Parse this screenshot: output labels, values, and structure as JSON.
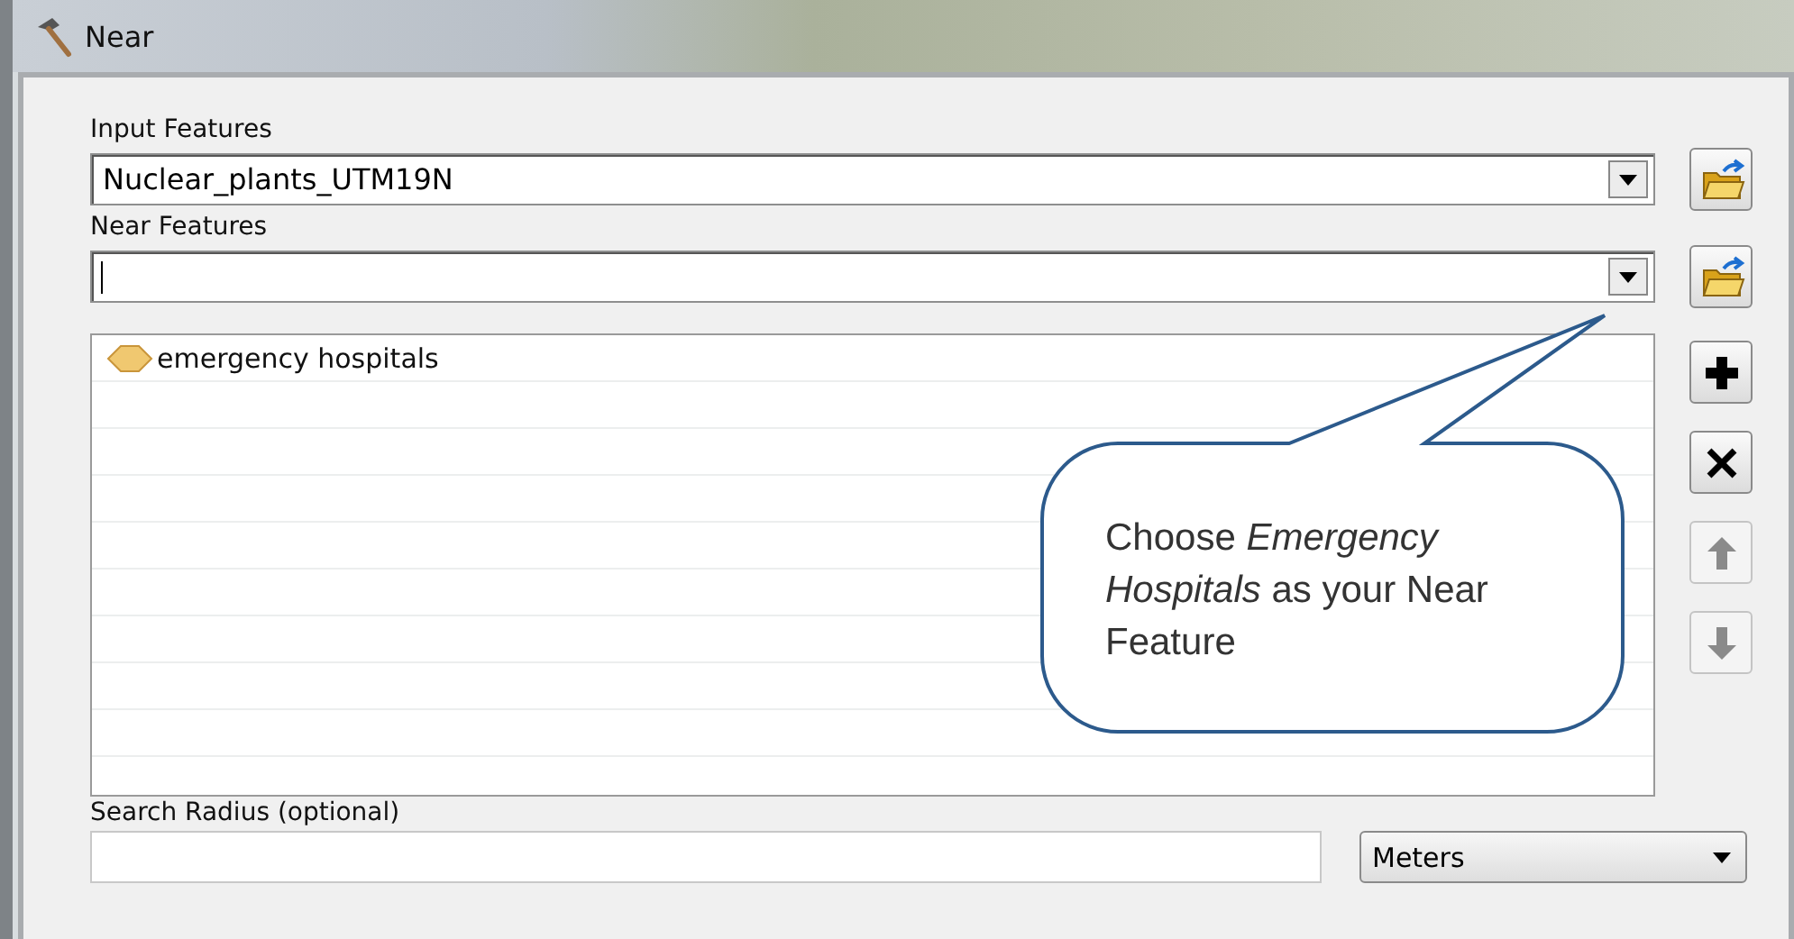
{
  "window": {
    "title": "Near"
  },
  "input_features": {
    "label": "Input Features",
    "value": "Nuclear_plants_UTM19N"
  },
  "near_features": {
    "label": "Near Features",
    "focused": true,
    "items": [
      {
        "name": "emergency hospitals"
      }
    ]
  },
  "list_buttons": [
    {
      "kind": "add",
      "disabled": false
    },
    {
      "kind": "remove",
      "disabled": false
    },
    {
      "kind": "up",
      "disabled": true
    },
    {
      "kind": "down",
      "disabled": true
    }
  ],
  "search_radius": {
    "label": "Search Radius (optional)",
    "unit": "Meters"
  },
  "callout": {
    "text": "Choose *Emergency Hospitals* as your Near Feature"
  }
}
